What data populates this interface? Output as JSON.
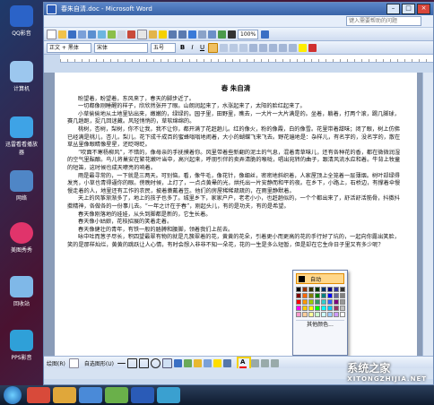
{
  "window": {
    "title": "春朱自清.doc - Microsoft Word"
  },
  "menu": {
    "help_placeholder": "键入需要帮助的问题"
  },
  "toolbar": {
    "zoom": "100%",
    "style": "正文 + 黑体",
    "font": "宋体",
    "size": "五号"
  },
  "document": {
    "title": "春 朱自清",
    "paragraphs": [
      "盼望着，盼望着，东风来了，春天的脚步近了。",
      "一切都像刚睡醒的样子，欣欣然张开了眼。山朗润起来了，水涨起来了，太阳的脸红起来了。",
      "小草偷偷地从土地里钻出来，嫩嫩的，绿绿的。园子里，田野里，瞧去，一大片一大片满是的。坐着，躺着，打两个滚，踢几脚球，赛几趟跑，捉几回迷藏。风轻悄悄的，草软绵绵的。",
      "桃树，杏树，梨树，你不让我，我不让你，都开满了花赶趟儿。红的像火，粉的像霞，白的像雪。花里带着甜味；闭了眼，树上仿佛已经满是桃儿，杏儿，梨儿。花下成千成百的蜜蜂嗡嗡地闹着，大小的蝴蝶飞来飞去。野花遍地是：杂样儿，有名字的，没名字的，散在草丛里像眼睛像星星，还眨呀眨。",
      "“吹面不寒杨柳风”，不错的，像母亲的手抚摸着你。风里带着些新翻的泥土的气息，混着青草味儿，还有各种花的香，都在微微润湿的空气里酝酿。鸟儿将巢安在繁花嫩叶当中，高兴起来，呼朋引伴的卖弄清脆的喉咙，唱出宛转的曲子，跟清风流水应和着。牛背上牧童的短笛，这时候也成天嘹亮的响着。",
      "雨是最寻常的，一下就是三两天。可别恼。看，像牛毛，像花针，像细丝，密密地斜织着，人家屋顶上全笼着一层薄烟。树叶却绿得发亮，小草也青得逼你的眼。傍晚时候，上灯了，一点点黄晕的光，烘托出一片安静而和平的夜。在乡下，小路上，石桥边，有撑着伞慢慢走着的人，地里还有工作的农民，披着蓑戴着笠。他们的房屋稀稀疏疏的，在雨里静默着。",
      "天上的风筝渐渐多了，地上的孩子也多了。城里乡下，家家户户，老老小小，也赶趟似的，一个个都出来了，舒活舒活筋骨，抖擞抖擞精神，各做各的一份事儿去。“一年之计在于春”，刚起头儿，有的是功夫，有的是希望。",
      "春天像刚落地的娃娃，从头到脚都是新的，它生长着。",
      "春天像小姑娘，花枝招展的笑着走着。",
      "春天像健壮的青年，有铁一般的胳膊和腰脚，领着我们上前去。",
      "咏中吐而葱子尽长，积四望最翠有物的就是几簇翠着的花，黄黄的花朵，引着更小而更高的花的手行好了坑的，一起向你露出笑脸，笑的是那样灿烂，黄黄的跳跃让人心情，有时会想入非非不知一朵花，花的一生是多么短暂，但是却在它生命日子里又有多少呢？"
    ]
  },
  "palette": {
    "auto_label": "自动",
    "more_label": "其他颜色...",
    "colors": [
      "#000000",
      "#993300",
      "#333300",
      "#003300",
      "#003366",
      "#000080",
      "#333399",
      "#333333",
      "#800000",
      "#FF6600",
      "#808000",
      "#008000",
      "#008080",
      "#0000FF",
      "#666699",
      "#808080",
      "#FF0000",
      "#FF9900",
      "#99CC00",
      "#339966",
      "#33CCCC",
      "#3366FF",
      "#800080",
      "#999999",
      "#FF00FF",
      "#FFCC00",
      "#FFFF00",
      "#00FF00",
      "#00FFFF",
      "#00CCFF",
      "#993366",
      "#C0C0C0",
      "#FF99CC",
      "#FFCC99",
      "#FFFF99",
      "#CCFFCC",
      "#CCFFFF",
      "#99CCFF",
      "#CC99FF",
      "#FFFFFF"
    ]
  },
  "drawbar": {
    "draw_label": "绘图(R)",
    "autoshape_label": "自选图形(U)"
  },
  "desktop_icons": [
    "QQ影音",
    "计算机",
    "迅雷看看播放器",
    "网络",
    "美图秀秀",
    "回收站",
    "PPS影音"
  ],
  "watermark": {
    "brand": "系统之家",
    "url": "XITONGZHIJIA.NET"
  }
}
